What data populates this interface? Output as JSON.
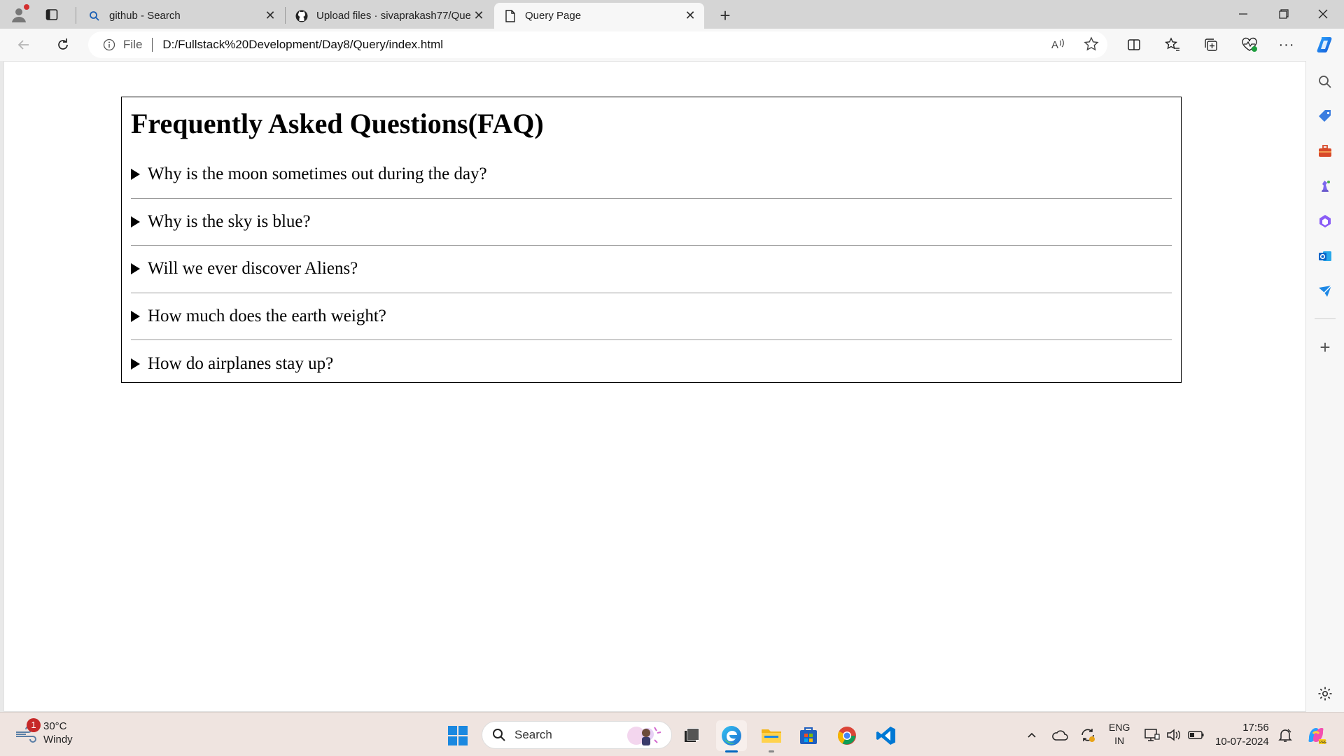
{
  "browser": {
    "tabs": [
      {
        "title": "github - Search",
        "icon": "search-icon"
      },
      {
        "title": "Upload files · sivaprakash77/Que",
        "icon": "github-icon"
      },
      {
        "title": "Query Page",
        "icon": "page-icon"
      }
    ],
    "address": {
      "scheme_label": "File",
      "url": "D:/Fullstack%20Development/Day8/Query/index.html"
    }
  },
  "page": {
    "heading": "Frequently Asked Questions(FAQ)",
    "questions": [
      "Why is the moon sometimes out during the day?",
      "Why is the sky is blue?",
      "Will we ever discover Aliens?",
      "How much does the earth weight?",
      "How do airplanes stay up?"
    ]
  },
  "taskbar": {
    "weather": {
      "temp": "30°C",
      "condition": "Windy",
      "badge": "1"
    },
    "search_placeholder": "Search",
    "lang": {
      "line1": "ENG",
      "line2": "IN"
    },
    "clock": {
      "time": "17:56",
      "date": "10-07-2024"
    }
  },
  "colors": {
    "edge_accent": "#0067c0",
    "tab_strip": "#d5d5d5",
    "toolbar": "#f7f7f7",
    "taskbar": "#efe4e0"
  }
}
